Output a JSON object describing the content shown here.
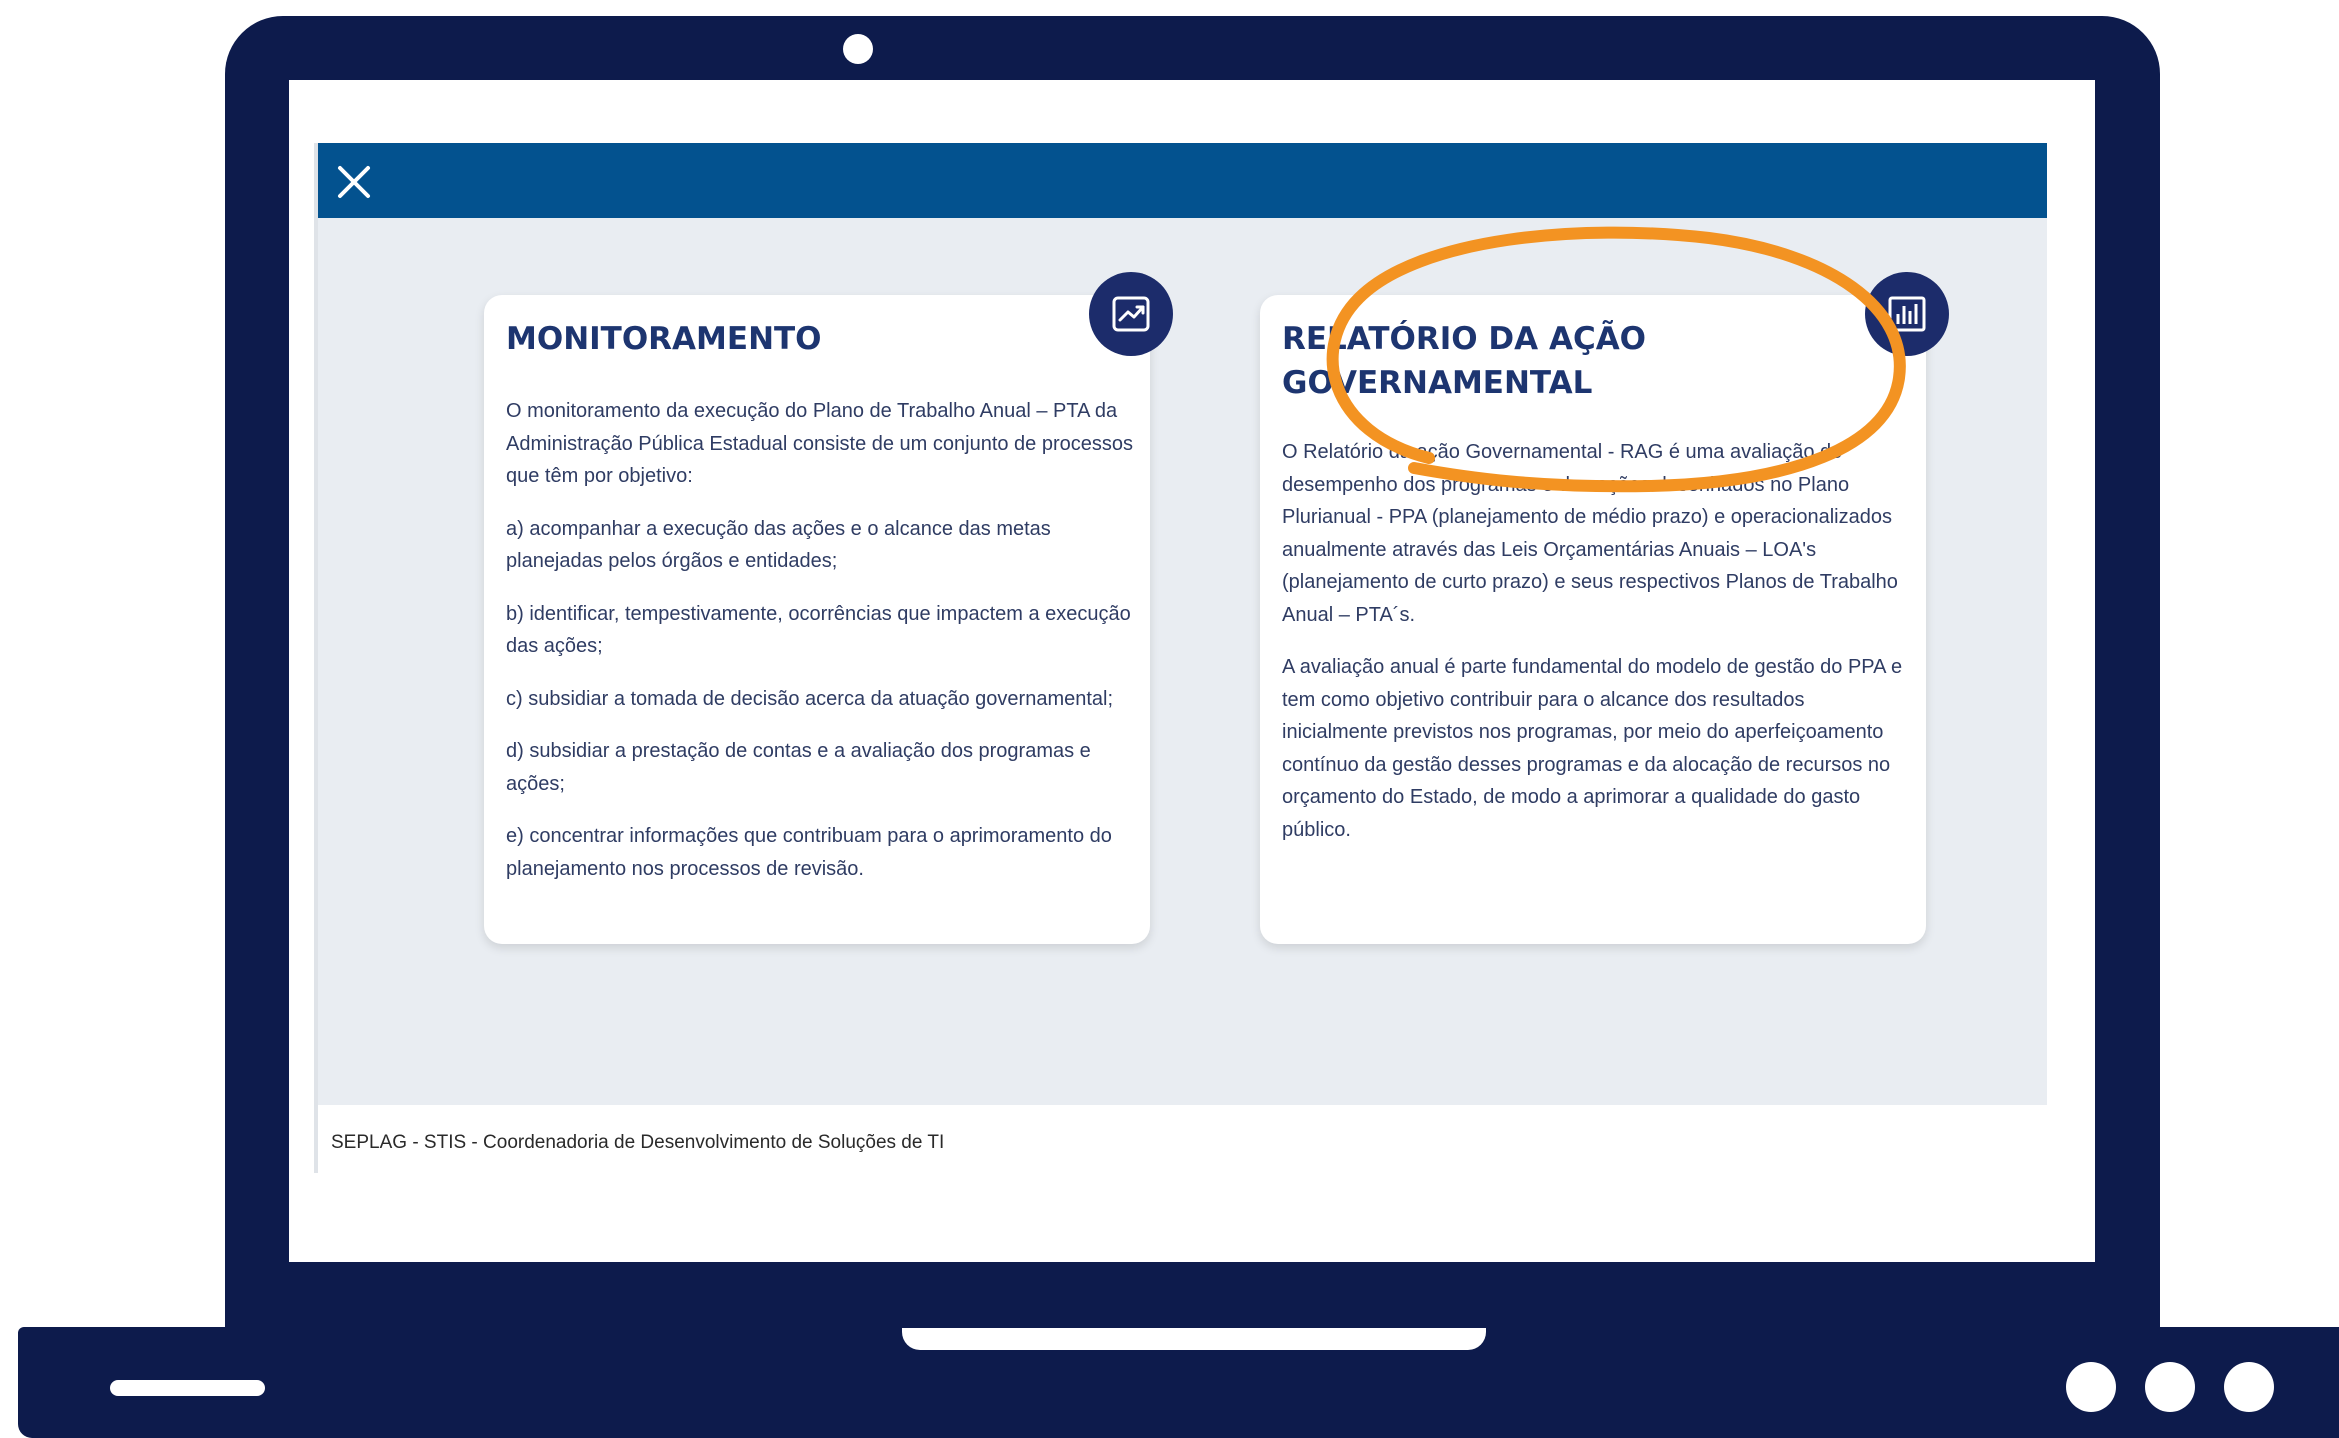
{
  "app": {
    "close_label": "×",
    "footer": "SEPLAG - STIS - Coordenadoria de Desenvolvimento de Soluções de TI"
  },
  "cards": [
    {
      "title": "MONITORAMENTO",
      "icon": "trending-up-chart-icon",
      "paragraphs": [
        "O monitoramento da execução do Plano de Trabalho Anual – PTA da Administração Pública Estadual consiste de um conjunto de processos que têm por objetivo:",
        "a) acompanhar a execução das ações e o alcance das metas planejadas pelos órgãos e entidades;",
        "b) identificar, tempestivamente, ocorrências que impactem a execução das ações;",
        "c) subsidiar a tomada de decisão acerca da atuação governamental;",
        "d) subsidiar a prestação de contas e a avaliação dos programas e ações;",
        "e) concentrar informações que contribuam para o aprimoramento do planejamento nos processos de revisão."
      ]
    },
    {
      "title": "RELATÓRIO DA AÇÃO GOVERNAMENTAL",
      "icon": "bar-chart-icon",
      "highlighted": true,
      "paragraphs": [
        "O Relatório da ação Governamental - RAG é uma avaliação do desempenho dos programas e das ações desenhados no Plano Plurianual - PPA (planejamento de médio prazo) e operacionalizados anualmente através das Leis Orçamentárias Anuais – LOA's (planejamento de curto prazo) e seus respectivos Planos de Trabalho Anual – PTA´s.",
        "A avaliação anual é parte fundamental do modelo de gestão do PPA e tem como objetivo contribuir para o alcance dos resultados inicialmente previstos nos programas, por meio do aperfeiçoamento contínuo da gestão desses programas e da alocação de recursos no orçamento do Estado, de modo a aprimorar a qualidade do gasto público."
      ]
    }
  ],
  "colors": {
    "laptop_frame": "#0d1b4c",
    "topbar": "#03528f",
    "content_bg": "#e9edf2",
    "card_title": "#1d3570",
    "icon_badge": "#1c2c6b",
    "highlight": "#f39322"
  }
}
